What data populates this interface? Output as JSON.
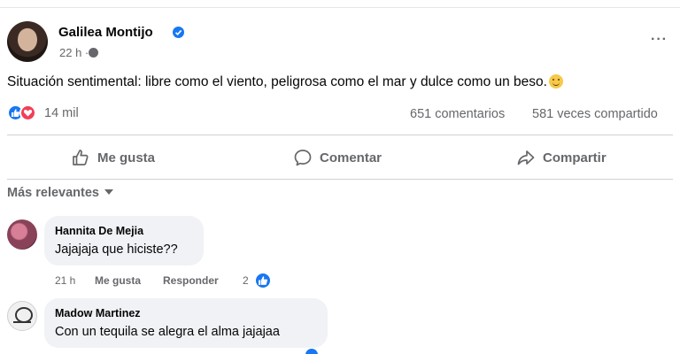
{
  "post": {
    "author": "Galilea Montijo",
    "time": "22 h ·",
    "text": "Situación sentimental: libre como el viento, peligrosa como el mar y dulce como un beso.",
    "more": "···"
  },
  "stats": {
    "reactions": "14 mil",
    "comments": "651 comentarios",
    "shares": "581 veces compartido"
  },
  "actions": {
    "like": "Me gusta",
    "comment": "Comentar",
    "share": "Compartir"
  },
  "sort": {
    "label": "Más relevantes"
  },
  "comments": [
    {
      "author": "Hannita De Mejia",
      "text": "Jajajaja que hiciste??",
      "time": "21 h",
      "like_label": "Me gusta",
      "reply_label": "Responder",
      "reaction_count": "2"
    },
    {
      "author": "Madow Martinez",
      "text": "Con un tequila se alegra el alma jajajaa"
    }
  ],
  "colors": {
    "accent": "#1877f2",
    "love": "#f33e58",
    "muted_text": "#65676b",
    "bubble": "#f0f2f5"
  },
  "icons": [
    "verified-icon",
    "globe-icon",
    "more-icon",
    "emoji-icon",
    "like-react-icon",
    "love-react-icon",
    "thumbs-up-icon",
    "comment-icon",
    "share-icon",
    "caret-down-icon"
  ]
}
